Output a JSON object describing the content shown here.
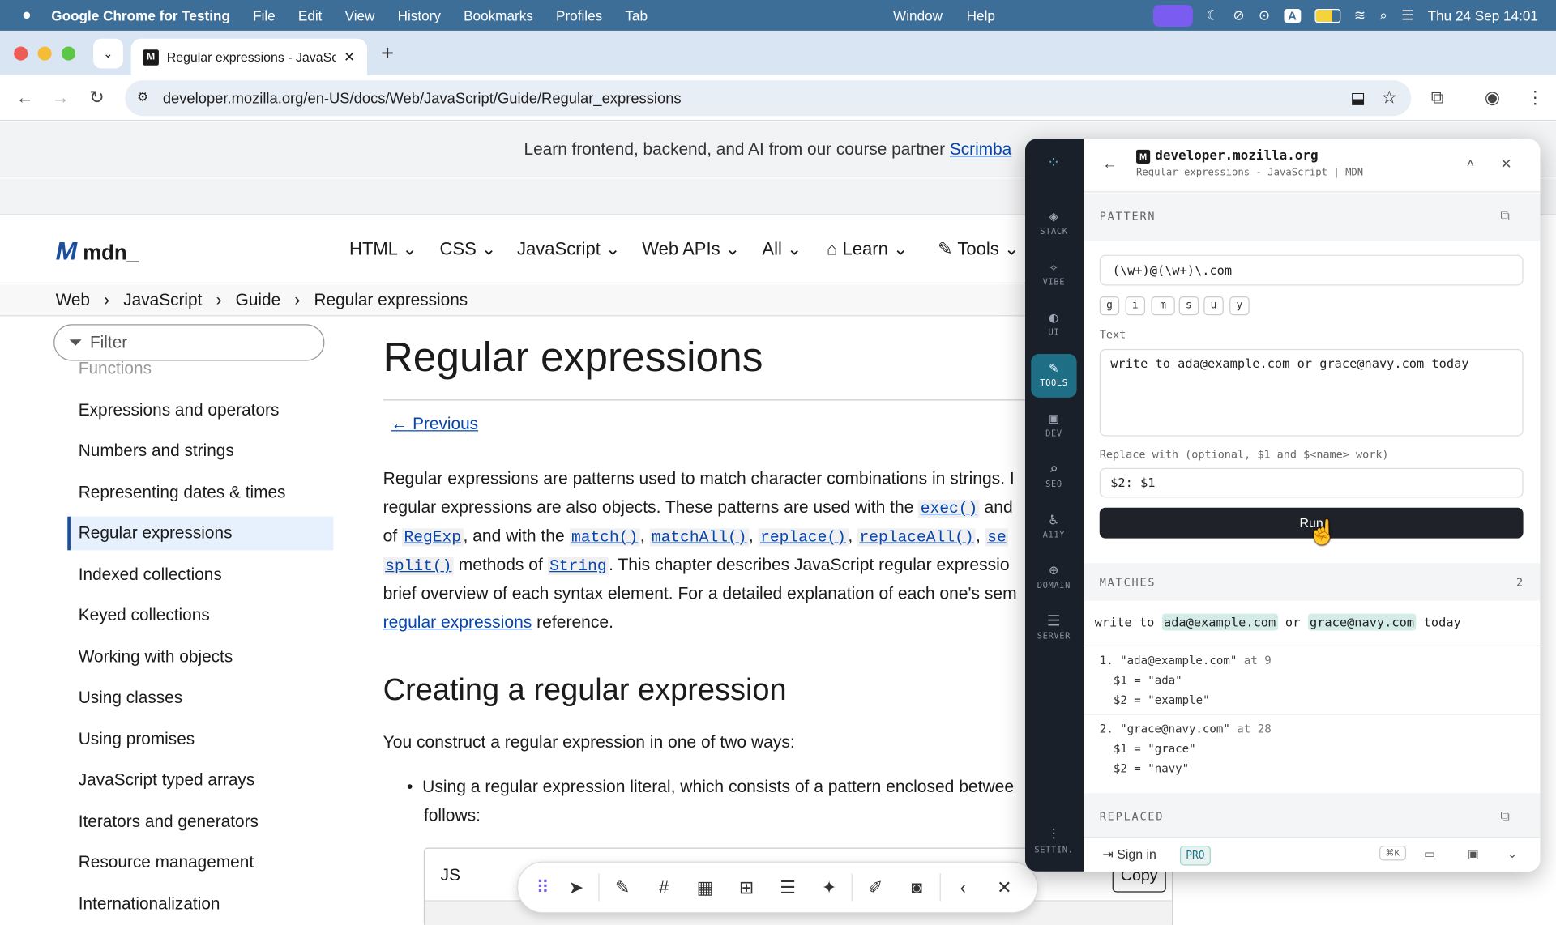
{
  "menubar": {
    "app": "Google Chrome for Testing",
    "items": [
      "File",
      "Edit",
      "View",
      "History",
      "Bookmarks",
      "Profiles",
      "Tab"
    ],
    "window": "Window",
    "help": "Help",
    "datetime": "Thu 24 Sep  14:01"
  },
  "tab": {
    "title": "Regular expressions - JavaSc",
    "favicon": "M"
  },
  "address": {
    "url": "developer.mozilla.org/en-US/docs/Web/JavaScript/Guide/Regular_expressions"
  },
  "banner": {
    "text": "Learn frontend, backend, and AI from our course partner",
    "link": "Scrimba"
  },
  "mdn": {
    "logo": "mdn_",
    "nav": [
      "HTML",
      "CSS",
      "JavaScript",
      "Web APIs",
      "All",
      "Learn",
      "Tools"
    ],
    "breadcrumb": [
      "Web",
      "JavaScript",
      "Guide",
      "Regular expressions"
    ],
    "filter_placeholder": "Filter",
    "sidebar": [
      "Functions",
      "Expressions and operators",
      "Numbers and strings",
      "Representing dates & times",
      "Regular expressions",
      "Indexed collections",
      "Keyed collections",
      "Working with objects",
      "Using classes",
      "Using promises",
      "JavaScript typed arrays",
      "Iterators and generators",
      "Resource management",
      "Internationalization"
    ],
    "title": "Regular expressions",
    "previous": "Previous",
    "intro": {
      "l1": "Regular expressions are patterns used to match character combinations in strings. I",
      "l2a": "regular expressions are also objects. These patterns are used with the ",
      "l2code": "exec()",
      "l2b": " and",
      "l3a": "of ",
      "l3c1": "RegExp",
      "l3b": ", and with the ",
      "l3c2": "match()",
      "l3c3": "matchAll()",
      "l3c4": "replace()",
      "l3c5": "replaceAll()",
      "l3c6": "se",
      "l4c1": "split()",
      "l4a": " methods of ",
      "l4c2": "String",
      "l4b": ". This chapter describes JavaScript regular expressio",
      "l5": "brief overview of each syntax element. For a detailed explanation of each one's sem",
      "l6link": "regular expressions",
      "l6": " reference."
    },
    "h2": "Creating a regular expression",
    "construct": "You construct a regular expression in one of two ways:",
    "bullet1": "Using a regular expression literal, which consists of a pattern enclosed betwee",
    "bullet1b": "follows:",
    "code_lang": "JS",
    "copy": "Copy"
  },
  "panel": {
    "domain": "developer.mozilla.org",
    "subtitle": "Regular expressions - JavaScript | MDN",
    "rail": [
      "STACK",
      "VIBE",
      "UI",
      "TOOLS",
      "DEV",
      "SEO",
      "A11Y",
      "DOMAIN",
      "SERVER"
    ],
    "settings": "SETTIN.",
    "pattern_label": "PATTERN",
    "pattern": "(\\w+)@(\\w+)\\.com",
    "flags": [
      "g",
      "i",
      "m",
      "s",
      "u",
      "y"
    ],
    "text_label": "Text",
    "text": "write to ada@example.com or grace@navy.com today",
    "replace_label": "Replace with (optional, $1 and $<name> work)",
    "replace": "$2: $1",
    "run": "Run",
    "matches_label": "MATCHES",
    "matches_count": "2",
    "preview": {
      "a": "write to ",
      "m1": "ada@example.com",
      "b": " or ",
      "m2": "grace@navy.com",
      "c": " today"
    },
    "m1": {
      "head": "1. \"ada@example.com\"",
      "at": " at 9",
      "g1": "$1 = \"ada\"",
      "g2": "$2 = \"example\""
    },
    "m2": {
      "head": "2. \"grace@navy.com\"",
      "at": " at 28",
      "g1": "$1 = \"grace\"",
      "g2": "$2 = \"navy\""
    },
    "replaced_label": "REPLACED",
    "signin": "Sign in",
    "pro": "PRO",
    "shortcut": "⌘K"
  }
}
